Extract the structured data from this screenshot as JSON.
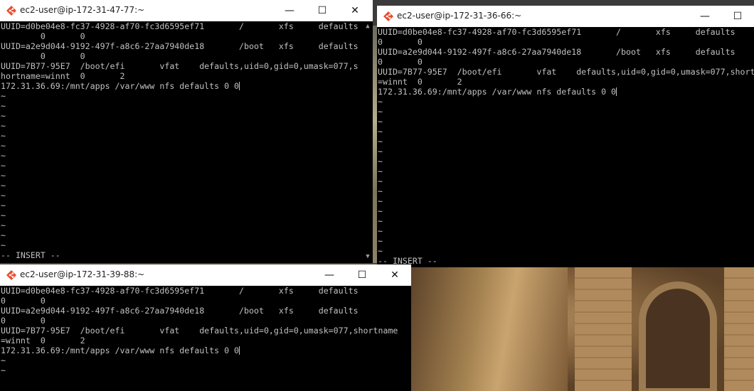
{
  "desktop": {
    "wallpaper": "stone-bridge-photo"
  },
  "windows": [
    {
      "id": "win-47-77",
      "title": "ec2-user@ip-172-31-47-77:~",
      "controls": {
        "minimize": "—",
        "maximize": "☐",
        "close": "✕"
      },
      "lines": [
        "UUID=d0be04e8-fc37-4928-af70-fc3d6595ef71       /       xfs     defaults",
        "        0       0",
        "UUID=a2e9d044-9192-497f-a8c6-27aa7940de18       /boot   xfs     defaults",
        "        0       0",
        "UUID=7B77-95E7  /boot/efi       vfat    defaults,uid=0,gid=0,umask=077,s",
        "hortname=winnt  0       2",
        "172.31.36.69:/mnt/apps /var/www nfs defaults 0 0"
      ],
      "tildes": 16,
      "status": "-- INSERT --"
    },
    {
      "id": "win-36-66",
      "title": "ec2-user@ip-172-31-36-66:~",
      "controls": {
        "minimize": "—",
        "maximize": "☐"
      },
      "lines": [
        "UUID=d0be04e8-fc37-4928-af70-fc3d6595ef71       /       xfs     defaults",
        "0       0",
        "UUID=a2e9d044-9192-497f-a8c6-27aa7940de18       /boot   xfs     defaults",
        "0       0",
        "UUID=7B77-95E7  /boot/efi       vfat    defaults,uid=0,gid=0,umask=077,short",
        "=winnt  0       2",
        "172.31.36.69:/mnt/apps /var/www nfs defaults 0 0"
      ],
      "tildes": 16,
      "status": "-- INSERT --"
    },
    {
      "id": "win-39-88",
      "title": "ec2-user@ip-172-31-39-88:~",
      "controls": {
        "minimize": "—",
        "maximize": "☐",
        "close": "✕"
      },
      "lines": [
        "UUID=d0be04e8-fc37-4928-af70-fc3d6595ef71       /       xfs     defaults",
        "0       0",
        "UUID=a2e9d044-9192-497f-a8c6-27aa7940de18       /boot   xfs     defaults",
        "0       0",
        "UUID=7B77-95E7  /boot/efi       vfat    defaults,uid=0,gid=0,umask=077,shortname",
        "=winnt  0       2",
        "172.31.36.69:/mnt/apps /var/www nfs defaults 0 0"
      ],
      "tildes": 2,
      "status": ""
    }
  ],
  "colors": {
    "terminal_bg": "#000000",
    "terminal_fg": "#c0c0c0",
    "titlebar_bg": "#ffffff"
  }
}
